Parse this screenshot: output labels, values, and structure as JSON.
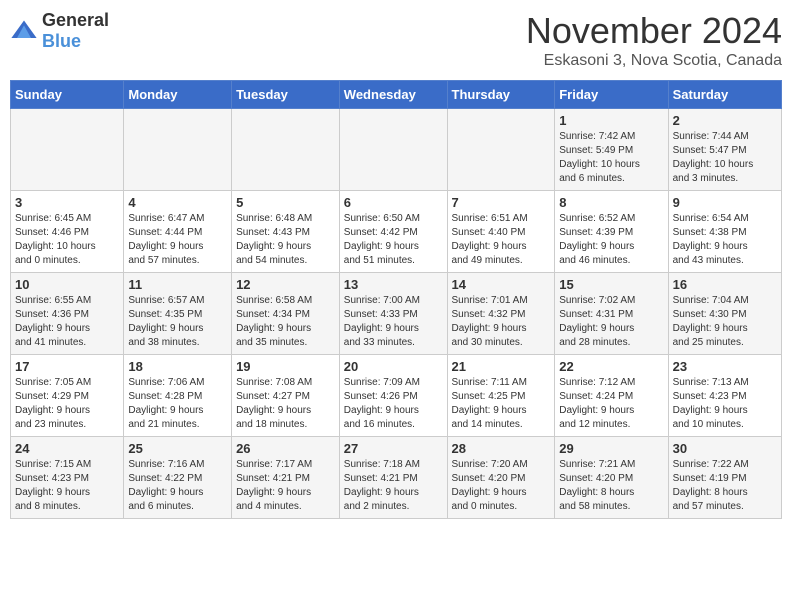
{
  "logo": {
    "general": "General",
    "blue": "Blue"
  },
  "title": {
    "month": "November 2024",
    "location": "Eskasoni 3, Nova Scotia, Canada"
  },
  "headers": [
    "Sunday",
    "Monday",
    "Tuesday",
    "Wednesday",
    "Thursday",
    "Friday",
    "Saturday"
  ],
  "weeks": [
    [
      {
        "day": "",
        "info": ""
      },
      {
        "day": "",
        "info": ""
      },
      {
        "day": "",
        "info": ""
      },
      {
        "day": "",
        "info": ""
      },
      {
        "day": "",
        "info": ""
      },
      {
        "day": "1",
        "info": "Sunrise: 7:42 AM\nSunset: 5:49 PM\nDaylight: 10 hours\nand 6 minutes."
      },
      {
        "day": "2",
        "info": "Sunrise: 7:44 AM\nSunset: 5:47 PM\nDaylight: 10 hours\nand 3 minutes."
      }
    ],
    [
      {
        "day": "3",
        "info": "Sunrise: 6:45 AM\nSunset: 4:46 PM\nDaylight: 10 hours\nand 0 minutes."
      },
      {
        "day": "4",
        "info": "Sunrise: 6:47 AM\nSunset: 4:44 PM\nDaylight: 9 hours\nand 57 minutes."
      },
      {
        "day": "5",
        "info": "Sunrise: 6:48 AM\nSunset: 4:43 PM\nDaylight: 9 hours\nand 54 minutes."
      },
      {
        "day": "6",
        "info": "Sunrise: 6:50 AM\nSunset: 4:42 PM\nDaylight: 9 hours\nand 51 minutes."
      },
      {
        "day": "7",
        "info": "Sunrise: 6:51 AM\nSunset: 4:40 PM\nDaylight: 9 hours\nand 49 minutes."
      },
      {
        "day": "8",
        "info": "Sunrise: 6:52 AM\nSunset: 4:39 PM\nDaylight: 9 hours\nand 46 minutes."
      },
      {
        "day": "9",
        "info": "Sunrise: 6:54 AM\nSunset: 4:38 PM\nDaylight: 9 hours\nand 43 minutes."
      }
    ],
    [
      {
        "day": "10",
        "info": "Sunrise: 6:55 AM\nSunset: 4:36 PM\nDaylight: 9 hours\nand 41 minutes."
      },
      {
        "day": "11",
        "info": "Sunrise: 6:57 AM\nSunset: 4:35 PM\nDaylight: 9 hours\nand 38 minutes."
      },
      {
        "day": "12",
        "info": "Sunrise: 6:58 AM\nSunset: 4:34 PM\nDaylight: 9 hours\nand 35 minutes."
      },
      {
        "day": "13",
        "info": "Sunrise: 7:00 AM\nSunset: 4:33 PM\nDaylight: 9 hours\nand 33 minutes."
      },
      {
        "day": "14",
        "info": "Sunrise: 7:01 AM\nSunset: 4:32 PM\nDaylight: 9 hours\nand 30 minutes."
      },
      {
        "day": "15",
        "info": "Sunrise: 7:02 AM\nSunset: 4:31 PM\nDaylight: 9 hours\nand 28 minutes."
      },
      {
        "day": "16",
        "info": "Sunrise: 7:04 AM\nSunset: 4:30 PM\nDaylight: 9 hours\nand 25 minutes."
      }
    ],
    [
      {
        "day": "17",
        "info": "Sunrise: 7:05 AM\nSunset: 4:29 PM\nDaylight: 9 hours\nand 23 minutes."
      },
      {
        "day": "18",
        "info": "Sunrise: 7:06 AM\nSunset: 4:28 PM\nDaylight: 9 hours\nand 21 minutes."
      },
      {
        "day": "19",
        "info": "Sunrise: 7:08 AM\nSunset: 4:27 PM\nDaylight: 9 hours\nand 18 minutes."
      },
      {
        "day": "20",
        "info": "Sunrise: 7:09 AM\nSunset: 4:26 PM\nDaylight: 9 hours\nand 16 minutes."
      },
      {
        "day": "21",
        "info": "Sunrise: 7:11 AM\nSunset: 4:25 PM\nDaylight: 9 hours\nand 14 minutes."
      },
      {
        "day": "22",
        "info": "Sunrise: 7:12 AM\nSunset: 4:24 PM\nDaylight: 9 hours\nand 12 minutes."
      },
      {
        "day": "23",
        "info": "Sunrise: 7:13 AM\nSunset: 4:23 PM\nDaylight: 9 hours\nand 10 minutes."
      }
    ],
    [
      {
        "day": "24",
        "info": "Sunrise: 7:15 AM\nSunset: 4:23 PM\nDaylight: 9 hours\nand 8 minutes."
      },
      {
        "day": "25",
        "info": "Sunrise: 7:16 AM\nSunset: 4:22 PM\nDaylight: 9 hours\nand 6 minutes."
      },
      {
        "day": "26",
        "info": "Sunrise: 7:17 AM\nSunset: 4:21 PM\nDaylight: 9 hours\nand 4 minutes."
      },
      {
        "day": "27",
        "info": "Sunrise: 7:18 AM\nSunset: 4:21 PM\nDaylight: 9 hours\nand 2 minutes."
      },
      {
        "day": "28",
        "info": "Sunrise: 7:20 AM\nSunset: 4:20 PM\nDaylight: 9 hours\nand 0 minutes."
      },
      {
        "day": "29",
        "info": "Sunrise: 7:21 AM\nSunset: 4:20 PM\nDaylight: 8 hours\nand 58 minutes."
      },
      {
        "day": "30",
        "info": "Sunrise: 7:22 AM\nSunset: 4:19 PM\nDaylight: 8 hours\nand 57 minutes."
      }
    ]
  ]
}
